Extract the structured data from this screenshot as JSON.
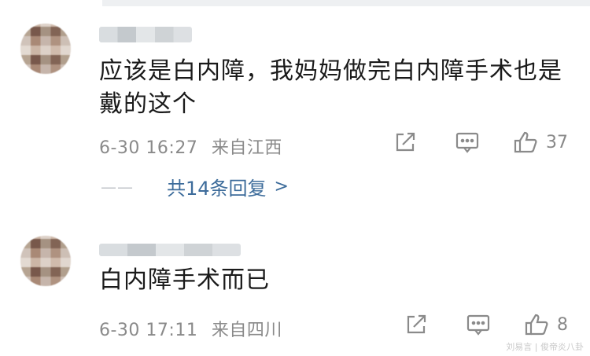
{
  "comments": [
    {
      "text": "应该是白内障，我妈妈做完白内障手术也是戴的这个",
      "time": "6-30 16:27",
      "location": "来自江西",
      "likes": "37",
      "replies": {
        "dash": "——",
        "label": "共14条回复",
        "chevron": ">"
      }
    },
    {
      "text": "白内障手术而已",
      "time": "6-30 17:11",
      "location": "来自四川",
      "likes": "8"
    }
  ],
  "icons": [
    "share-icon",
    "comment-icon",
    "like-icon"
  ],
  "colors": {
    "meta": "#8a8a8a",
    "link": "#3d6c9b",
    "text": "#1a1a1a"
  },
  "watermark": "刘易言 | 俊帝炎八卦"
}
